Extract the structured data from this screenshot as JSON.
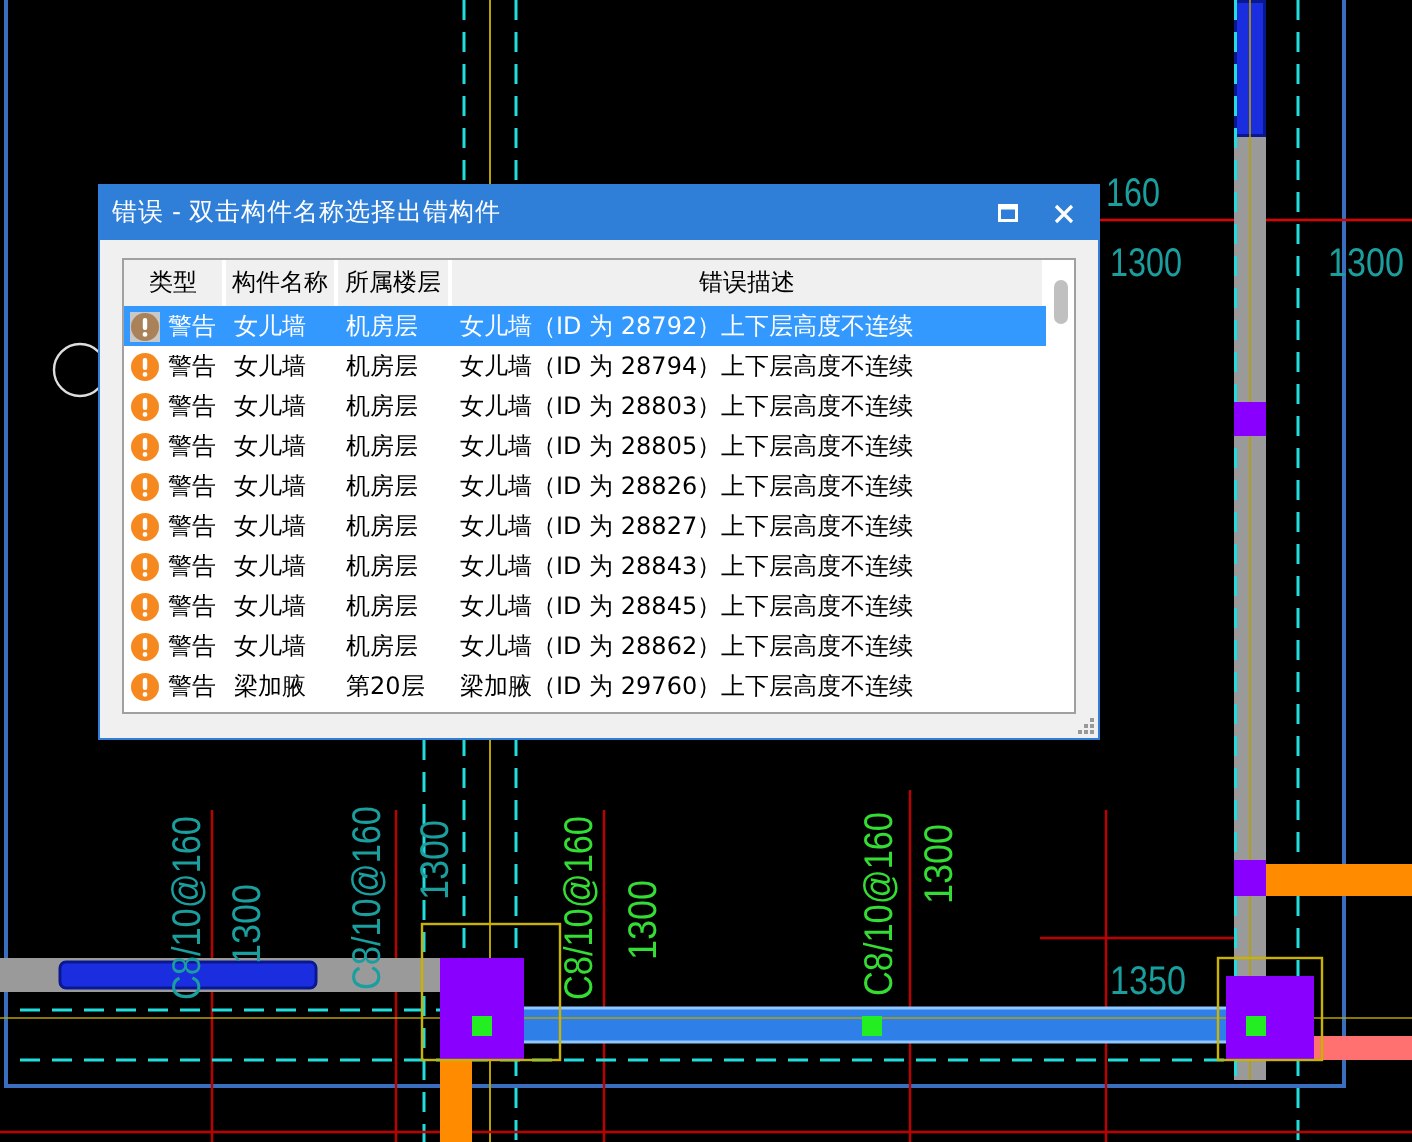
{
  "canvas_labels": [
    {
      "text": "160"
    },
    {
      "text": "1300"
    },
    {
      "text": "1300"
    },
    {
      "text": "C8/10@160"
    },
    {
      "text": "1300"
    },
    {
      "text": "C8/10@160"
    },
    {
      "text": "1300"
    },
    {
      "text": "C8/10@160"
    },
    {
      "text": "1300"
    },
    {
      "text": "C8/10@160"
    },
    {
      "text": "1300"
    },
    {
      "text": "1350"
    }
  ],
  "dialog": {
    "title": "错误 - 双击构件名称选择出错构件",
    "columns": [
      "类型",
      "构件名称",
      "所属楼层",
      "错误描述"
    ],
    "rows": [
      {
        "type": "警告",
        "name": "女儿墙",
        "floor": "机房层",
        "description": "女儿墙（ID 为 28792）上下层高度不连续",
        "selected": true
      },
      {
        "type": "警告",
        "name": "女儿墙",
        "floor": "机房层",
        "description": "女儿墙（ID 为 28794）上下层高度不连续",
        "selected": false
      },
      {
        "type": "警告",
        "name": "女儿墙",
        "floor": "机房层",
        "description": "女儿墙（ID 为 28803）上下层高度不连续",
        "selected": false
      },
      {
        "type": "警告",
        "name": "女儿墙",
        "floor": "机房层",
        "description": "女儿墙（ID 为 28805）上下层高度不连续",
        "selected": false
      },
      {
        "type": "警告",
        "name": "女儿墙",
        "floor": "机房层",
        "description": "女儿墙（ID 为 28826）上下层高度不连续",
        "selected": false
      },
      {
        "type": "警告",
        "name": "女儿墙",
        "floor": "机房层",
        "description": "女儿墙（ID 为 28827）上下层高度不连续",
        "selected": false
      },
      {
        "type": "警告",
        "name": "女儿墙",
        "floor": "机房层",
        "description": "女儿墙（ID 为 28843）上下层高度不连续",
        "selected": false
      },
      {
        "type": "警告",
        "name": "女儿墙",
        "floor": "机房层",
        "description": "女儿墙（ID 为 28845）上下层高度不连续",
        "selected": false
      },
      {
        "type": "警告",
        "name": "女儿墙",
        "floor": "机房层",
        "description": "女儿墙（ID 为 28862）上下层高度不连续",
        "selected": false
      },
      {
        "type": "警告",
        "name": "梁加腋",
        "floor": "第20层",
        "description": "梁加腋（ID 为 29760）上下层高度不连续",
        "selected": false
      }
    ]
  }
}
